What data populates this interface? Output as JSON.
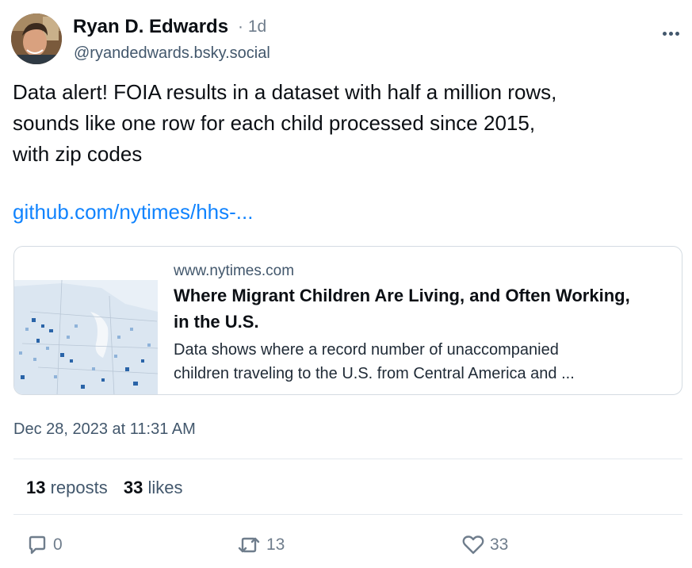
{
  "author": {
    "name": "Ryan D. Edwards",
    "separator_time": "· 1d",
    "handle": "@ryandedwards.bsky.social"
  },
  "post": {
    "text_lines": [
      "Data alert! FOIA results in a dataset with half a million rows,",
      "sounds like one row for each child processed since 2015,",
      "with zip codes"
    ],
    "link_text": "github.com/nytimes/hhs-..."
  },
  "link_card": {
    "domain": "www.nytimes.com",
    "title": "Where Migrant Children Are Living, and Often Working, in the U.S.",
    "description_lines": [
      "Data shows where a record number of unaccompanied",
      "children traveling to the U.S. from Central America and ..."
    ]
  },
  "timestamp": "Dec 28, 2023 at 11:31 AM",
  "stats": {
    "reposts_count": "13",
    "reposts_label": "reposts",
    "likes_count": "33",
    "likes_label": "likes"
  },
  "actions": {
    "reply_count": "0",
    "repost_count": "13",
    "like_count": "33"
  },
  "icons": {
    "more": "more-icon",
    "reply": "reply-icon",
    "repost": "repost-icon",
    "like": "heart-icon"
  },
  "colors": {
    "link": "#1083fe",
    "muted": "#42576c",
    "icon": "#6f7d8c"
  }
}
